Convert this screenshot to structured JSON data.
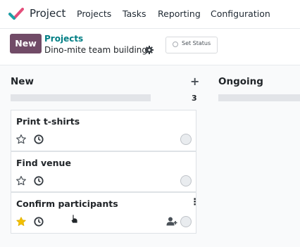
{
  "app": {
    "name": "Project"
  },
  "nav": {
    "items": [
      "Projects",
      "Tasks",
      "Reporting",
      "Configuration"
    ]
  },
  "control": {
    "new_label": "New",
    "breadcrumb": "Projects",
    "record_name": "Dino-mite team building",
    "status_label": "Set Status"
  },
  "columns": [
    {
      "title": "New",
      "count": "3",
      "cards": [
        {
          "title": "Print t-shirts",
          "starred": false
        },
        {
          "title": "Find venue",
          "starred": false
        },
        {
          "title": "Confirm participants",
          "starred": true
        }
      ]
    },
    {
      "title": "Ongoing"
    }
  ],
  "colors": {
    "brand": "#714b67",
    "link": "#017e84",
    "star_active": "#f3c000"
  },
  "icons": {
    "logo": "odoo-project-check-logo",
    "gear": "gear-icon",
    "star": "star-icon",
    "clock": "clock-icon",
    "assign": "add-user-icon",
    "kebab": "dots-vertical-icon",
    "add": "plus-icon"
  }
}
